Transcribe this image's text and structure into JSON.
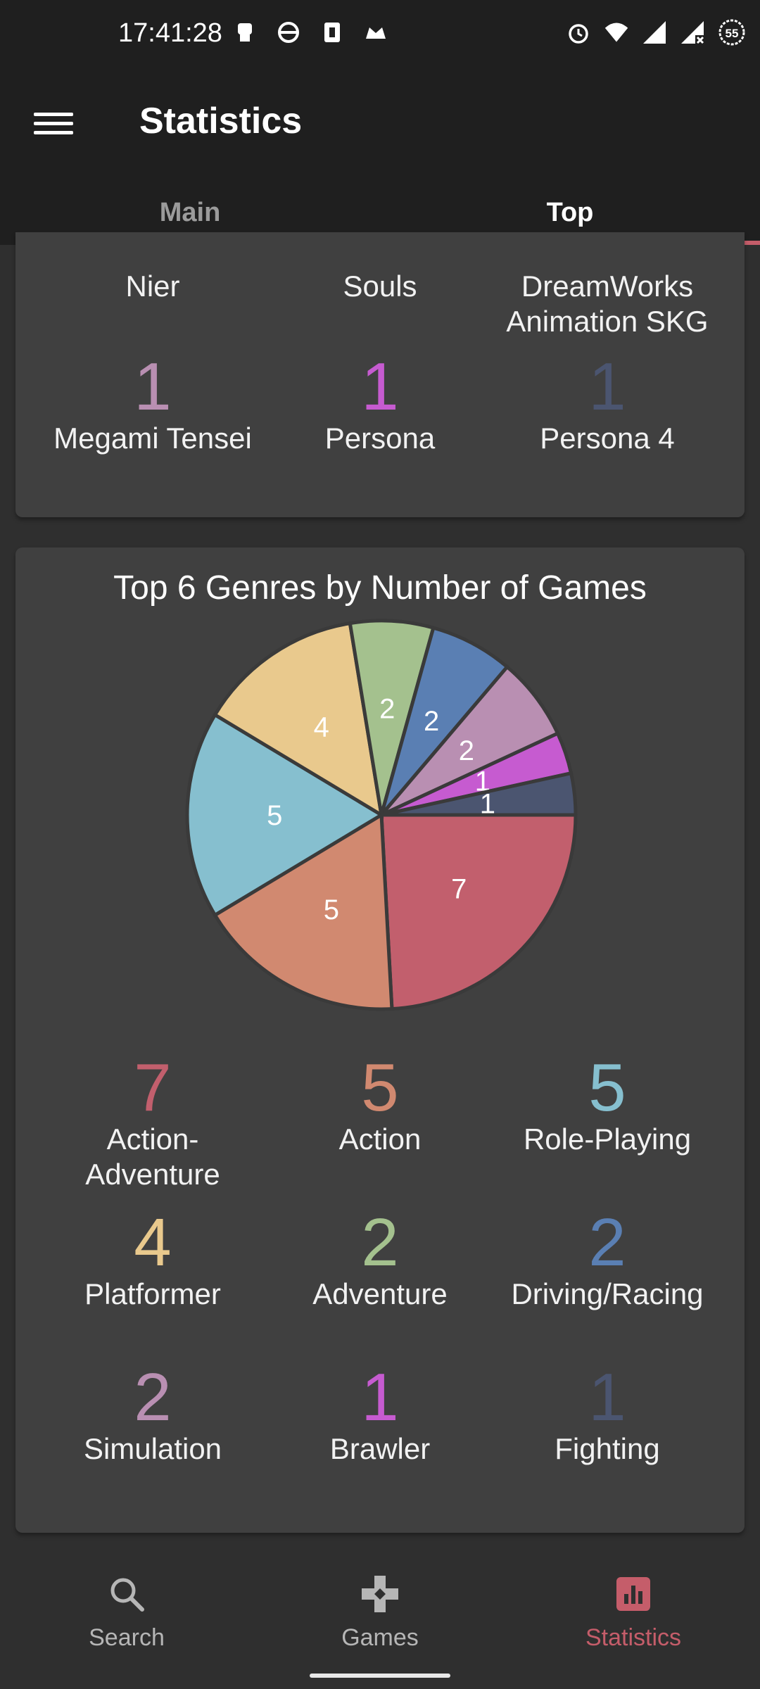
{
  "status_bar": {
    "time": "17:41:28",
    "battery": "55"
  },
  "app_bar": {
    "title": "Statistics"
  },
  "tabs": [
    {
      "label": "Main"
    },
    {
      "label": "Top"
    }
  ],
  "franchises": {
    "top_labels": [
      "Nier",
      "Souls",
      "DreamWorks Animation SKG"
    ],
    "items": [
      {
        "value": "1",
        "label": "Megami Tensei",
        "color": "#b98fb2"
      },
      {
        "value": "1",
        "label": "Persona",
        "color": "#c65bd0"
      },
      {
        "value": "1",
        "label": "Persona 4",
        "color": "#4b5570"
      }
    ]
  },
  "genres": {
    "title": "Top 6 Genres by Number of Games",
    "items": [
      {
        "value": "7",
        "label": "Action-Adventure",
        "color": "#c25f6d"
      },
      {
        "value": "5",
        "label": "Action",
        "color": "#d18970"
      },
      {
        "value": "5",
        "label": "Role-Playing",
        "color": "#86bfcf"
      },
      {
        "value": "4",
        "label": "Platformer",
        "color": "#e9c98d"
      },
      {
        "value": "2",
        "label": "Adventure",
        "color": "#a4c18e"
      },
      {
        "value": "2",
        "label": "Driving/Racing",
        "color": "#5a7fb3"
      },
      {
        "value": "2",
        "label": "Simulation",
        "color": "#b98fb2"
      },
      {
        "value": "1",
        "label": "Brawler",
        "color": "#c65bd0"
      },
      {
        "value": "1",
        "label": "Fighting",
        "color": "#4b5570"
      }
    ]
  },
  "chart_data": {
    "type": "pie",
    "title": "Top 6 Genres by Number of Games",
    "categories": [
      "Action-Adventure",
      "Action",
      "Role-Playing",
      "Platformer",
      "Adventure",
      "Driving/Racing",
      "Simulation",
      "Brawler",
      "Fighting"
    ],
    "values": [
      7,
      5,
      5,
      4,
      2,
      2,
      2,
      1,
      1
    ],
    "colors": [
      "#c25f6d",
      "#d18970",
      "#86bfcf",
      "#e9c98d",
      "#a4c18e",
      "#5a7fb3",
      "#b98fb2",
      "#c65bd0",
      "#4b5570"
    ]
  },
  "bottom_nav": [
    {
      "label": "Search",
      "icon": "search-icon"
    },
    {
      "label": "Games",
      "icon": "gamepad-icon"
    },
    {
      "label": "Statistics",
      "icon": "bar-chart-icon",
      "active": true
    }
  ]
}
